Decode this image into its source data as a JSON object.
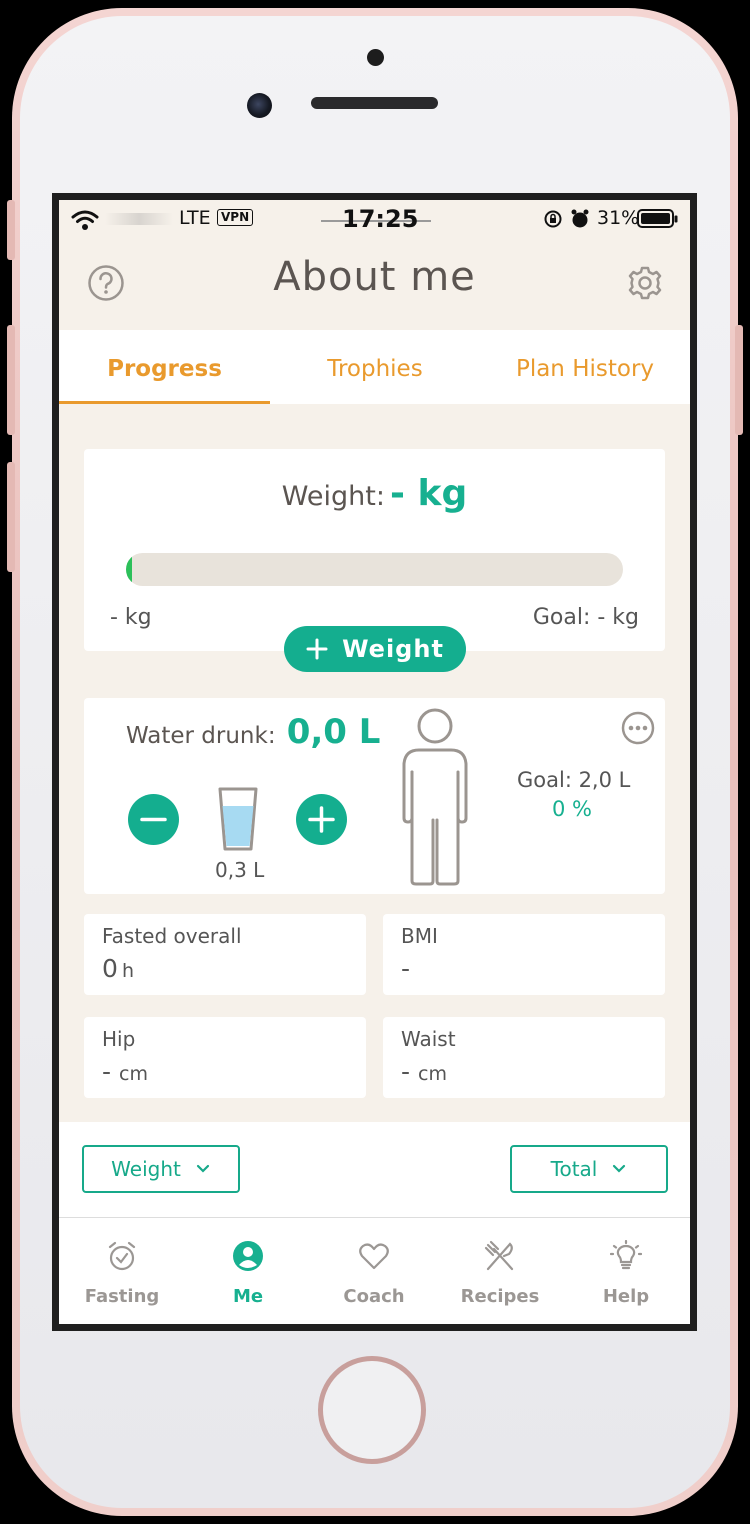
{
  "status_bar": {
    "carrier": "LTE",
    "vpn": "VPN",
    "time": "17:25",
    "battery": "31%"
  },
  "header": {
    "title": "About me",
    "help_icon": "question-circle-icon",
    "settings_icon": "gear-icon"
  },
  "tabs": [
    {
      "label": "Progress",
      "active": true
    },
    {
      "label": "Trophies",
      "active": false
    },
    {
      "label": "Plan History",
      "active": false
    }
  ],
  "weight_card": {
    "label": "Weight:",
    "value": "- kg",
    "progress_fraction": 0.01,
    "start_label": "- kg",
    "goal_label": "Goal: - kg",
    "add_button": "Weight"
  },
  "water_card": {
    "label": "Water drunk:",
    "value": "0,0 L",
    "glass_size": "0,3 L",
    "goal": "Goal: 2,0 L",
    "percent": "0 %"
  },
  "stats": [
    {
      "label": "Fasted overall",
      "value": "0",
      "unit": "h"
    },
    {
      "label": "BMI",
      "value": "-",
      "unit": ""
    },
    {
      "label": "Hip",
      "value": "-",
      "unit": "cm"
    },
    {
      "label": "Waist",
      "value": "-",
      "unit": "cm"
    }
  ],
  "filters": {
    "metric": "Weight",
    "range": "Total"
  },
  "tab_bar": [
    {
      "label": "Fasting",
      "icon": "alarm-clock-icon",
      "active": false
    },
    {
      "label": "Me",
      "icon": "user-circle-icon",
      "active": true
    },
    {
      "label": "Coach",
      "icon": "heart-icon",
      "active": false
    },
    {
      "label": "Recipes",
      "icon": "fork-knife-icon",
      "active": false
    },
    {
      "label": "Help",
      "icon": "lightbulb-icon",
      "active": false
    }
  ],
  "colors": {
    "accent": "#17b090",
    "tab_orange": "#e99a2d",
    "background": "#f6f1ea",
    "inactive": "#9b9794"
  }
}
